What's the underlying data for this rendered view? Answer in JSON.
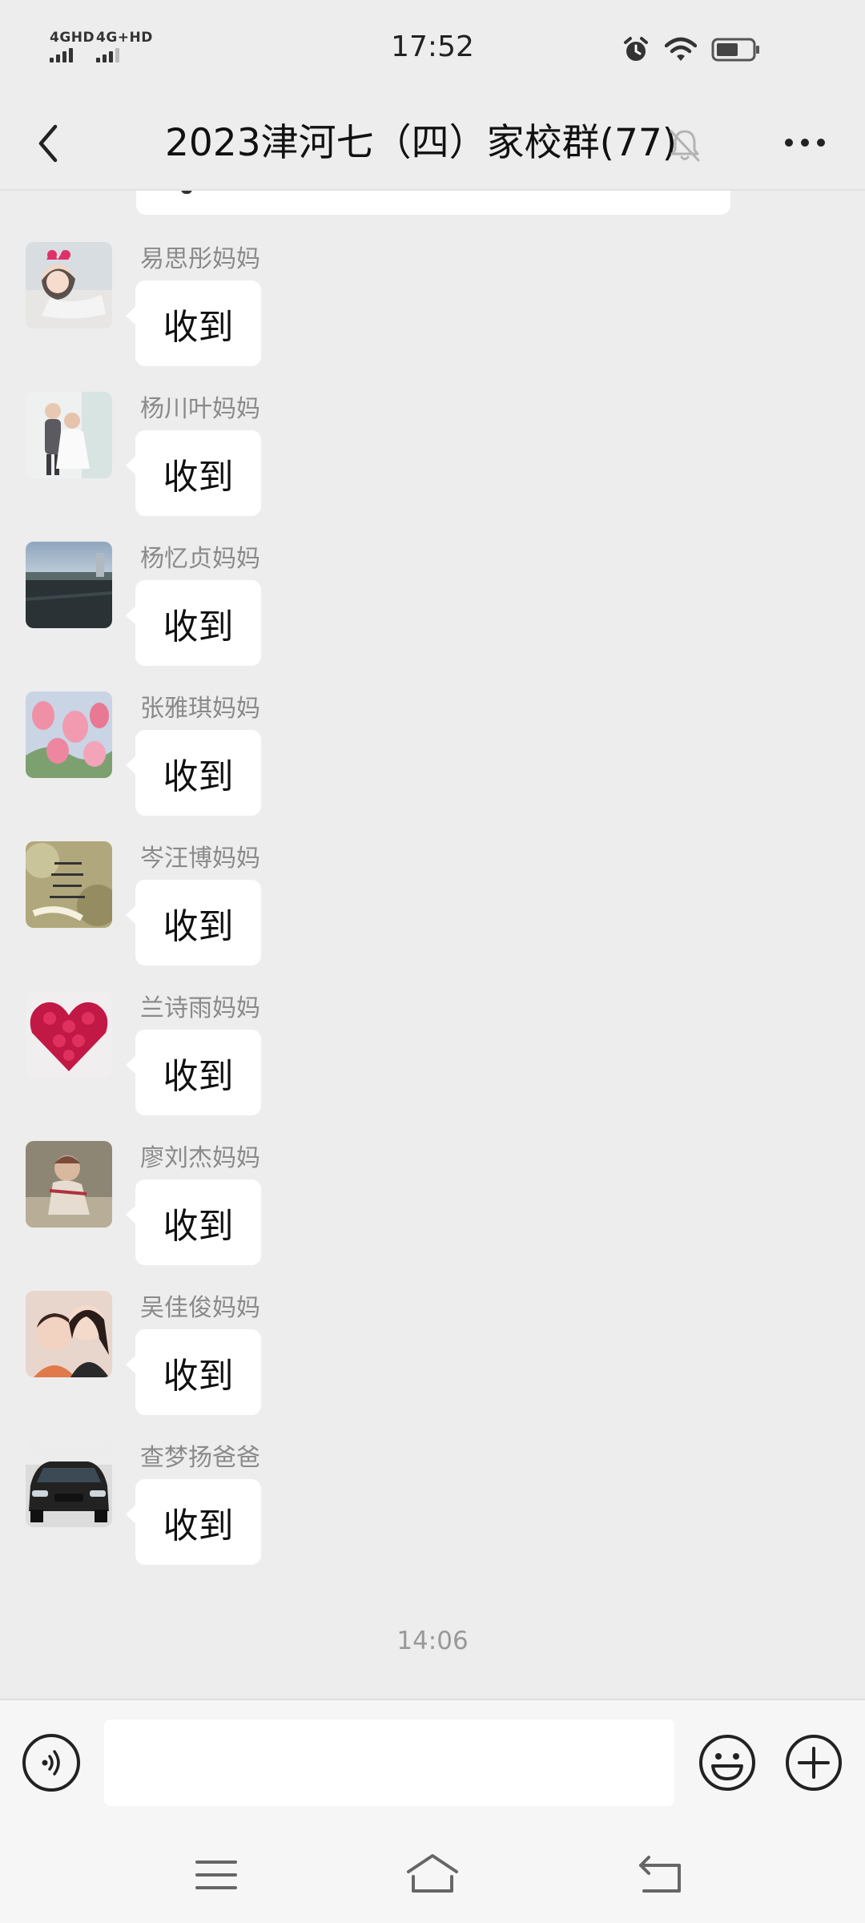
{
  "status_bar": {
    "sim1_label": "4GHD",
    "sim2_label": "4G+HD",
    "time": "17:52",
    "icons": [
      "alarm-icon",
      "wifi-icon",
      "battery-icon"
    ]
  },
  "header": {
    "title": "2023津河七（四）家校群(77)",
    "icons": [
      "back-arrow-icon",
      "mute-bell-icon",
      "more-icon"
    ]
  },
  "messages": [
    {
      "sender": "易思彤妈妈",
      "text": "收到"
    },
    {
      "sender": "杨川叶妈妈",
      "text": "收到"
    },
    {
      "sender": "杨忆贞妈妈",
      "text": "收到"
    },
    {
      "sender": "张雅琪妈妈",
      "text": "收到"
    },
    {
      "sender": "岑汪博妈妈",
      "text": "收到"
    },
    {
      "sender": "兰诗雨妈妈",
      "text": "收到"
    },
    {
      "sender": "廖刘杰妈妈",
      "text": "收到"
    },
    {
      "sender": "吴佳俊妈妈",
      "text": "收到"
    },
    {
      "sender": "查梦扬爸爸",
      "text": "收到"
    }
  ],
  "timestamp": "14:06",
  "input_bar": {
    "value": "",
    "icons": [
      "voice-icon",
      "emoji-icon",
      "plus-icon"
    ]
  },
  "nav_bar": {
    "icons": [
      "menu-icon",
      "home-icon",
      "back-icon"
    ]
  },
  "colors": {
    "chat_background": "#ededed",
    "bubble": "#ffffff",
    "sender_name": "#8a8a8a",
    "bars": "#f6f6f6"
  }
}
